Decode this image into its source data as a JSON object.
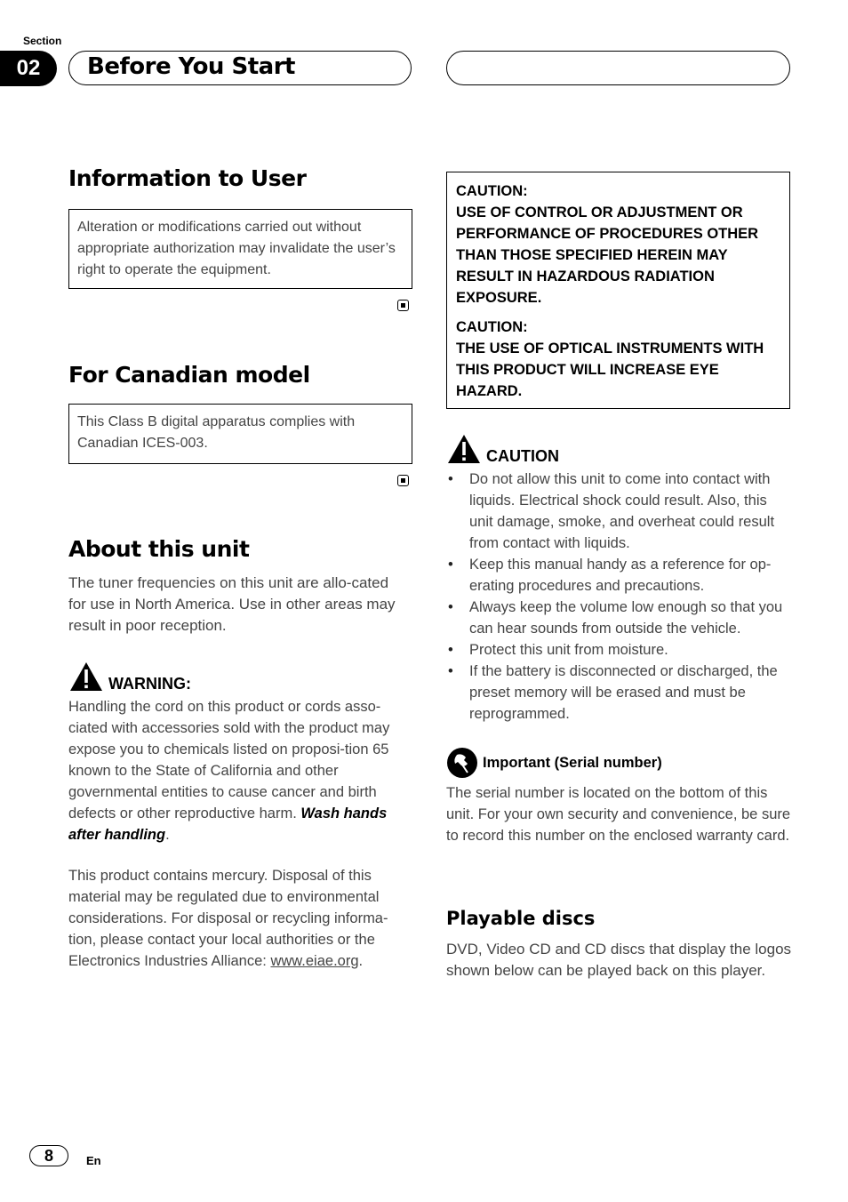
{
  "header": {
    "section_label": "Section",
    "section_number": "02",
    "title": "Before You Start"
  },
  "info_to_user": {
    "heading": "Information to User",
    "notice": "Alteration or modifications carried out without appropriate authorization may invalidate the user’s right to operate the equipment."
  },
  "canadian_model": {
    "heading": "For Canadian model",
    "notice": "This Class B digital apparatus complies with Canadian ICES-003."
  },
  "about_unit": {
    "heading": "About this unit",
    "body": "The tuner frequencies on this unit are allo-cated for use in North America. Use in other areas may result in poor reception."
  },
  "warning": {
    "label": "WARNING:",
    "body": "Handling the cord on this product or cords asso-ciated with accessories sold with the product may expose you to chemicals listed on proposi-tion 65 known to the State of California and other governmental entities to cause cancer and birth defects or other reproductive harm. ",
    "emphasis": "Wash hands after handling",
    "end": ".",
    "mercury_text": "This product contains mercury. Disposal of this material may be regulated due to environmental considerations. For disposal or recycling informa-tion, please contact your local authorities or the Electronics Industries Alliance: ",
    "mercury_link": "www.eiae.org",
    "mercury_end": "."
  },
  "caution_box": {
    "block1_label": "CAUTION:",
    "block1_text": "USE OF CONTROL OR ADJUSTMENT OR PERFORMANCE OF PROCEDURES OTHER THAN THOSE SPECIFIED HEREIN MAY RESULT IN HAZARDOUS RADIATION EXPOSURE.",
    "block2_label": "CAUTION:",
    "block2_text": "THE USE OF OPTICAL INSTRUMENTS WITH THIS PRODUCT WILL INCREASE EYE HAZARD."
  },
  "caution": {
    "label": "CAUTION",
    "items": [
      "Do not allow this unit to come into contact with liquids. Electrical shock could result. Also, this unit damage, smoke, and overheat could result from contact with liquids.",
      "Keep this manual handy as a reference for op-erating procedures and precautions.",
      "Always keep the volume low enough so that you can hear sounds from outside the vehicle.",
      "Protect this unit from moisture.",
      "If the battery is disconnected or discharged, the preset memory will be erased and must be reprogrammed."
    ]
  },
  "important": {
    "label": "Important (Serial number)",
    "body": "The serial number is located on the bottom of this unit. For your own security and convenience, be sure to record this number on the enclosed warranty card."
  },
  "playable_discs": {
    "heading": "Playable discs",
    "body": "DVD, Video CD and CD discs that display the logos shown below can be played back on this player."
  },
  "footer": {
    "page_number": "8",
    "language": "En"
  }
}
